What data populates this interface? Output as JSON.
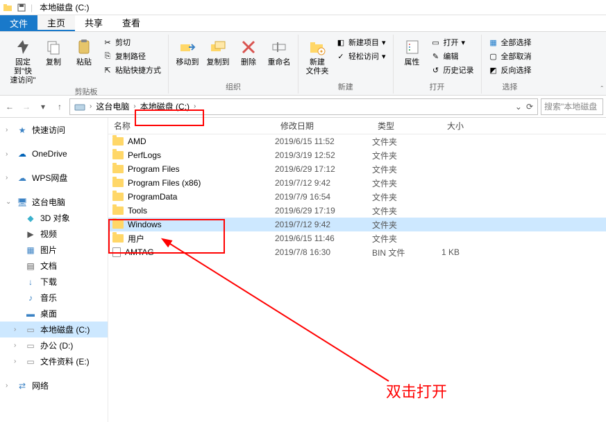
{
  "titlebar": {
    "title": "本地磁盘 (C:)"
  },
  "menubar": {
    "file": "文件",
    "tabs": [
      "主页",
      "共享",
      "查看"
    ],
    "active": 0
  },
  "ribbon": {
    "pin": {
      "label": "固定到\"快\n速访问\""
    },
    "copy": {
      "label": "复制"
    },
    "paste": {
      "label": "粘贴"
    },
    "cut": {
      "label": "剪切"
    },
    "copy_path": {
      "label": "复制路径"
    },
    "paste_shortcut": {
      "label": "粘贴快捷方式"
    },
    "clipboard": {
      "label": "剪贴板"
    },
    "move_to": {
      "label": "移动到"
    },
    "copy_to": {
      "label": "复制到"
    },
    "delete": {
      "label": "删除"
    },
    "rename": {
      "label": "重命名"
    },
    "organize": {
      "label": "组织"
    },
    "new_folder": {
      "label": "新建\n文件夹"
    },
    "new_item": {
      "label": "新建项目"
    },
    "easy_access": {
      "label": "轻松访问"
    },
    "new": {
      "label": "新建"
    },
    "properties": {
      "label": "属性"
    },
    "open": {
      "label": "打开"
    },
    "edit": {
      "label": "编辑"
    },
    "history": {
      "label": "历史记录"
    },
    "open_group": {
      "label": "打开"
    },
    "select_all": {
      "label": "全部选择"
    },
    "select_none": {
      "label": "全部取消"
    },
    "invert_selection": {
      "label": "反向选择"
    },
    "select": {
      "label": "选择"
    }
  },
  "breadcrumb": {
    "items": [
      "这台电脑",
      "本地磁盘 (C:)"
    ]
  },
  "search": {
    "placeholder": "搜索\"本地磁盘"
  },
  "columns": {
    "name": "名称",
    "date": "修改日期",
    "type": "类型",
    "size": "大小"
  },
  "files": [
    {
      "name": "AMD",
      "date": "2019/6/15 11:52",
      "type": "文件夹",
      "size": "",
      "icon": "folder"
    },
    {
      "name": "PerfLogs",
      "date": "2019/3/19 12:52",
      "type": "文件夹",
      "size": "",
      "icon": "folder"
    },
    {
      "name": "Program Files",
      "date": "2019/6/29 17:12",
      "type": "文件夹",
      "size": "",
      "icon": "folder"
    },
    {
      "name": "Program Files (x86)",
      "date": "2019/7/12 9:42",
      "type": "文件夹",
      "size": "",
      "icon": "folder"
    },
    {
      "name": "ProgramData",
      "date": "2019/7/9 16:54",
      "type": "文件夹",
      "size": "",
      "icon": "folder"
    },
    {
      "name": "Tools",
      "date": "2019/6/29 17:19",
      "type": "文件夹",
      "size": "",
      "icon": "folder"
    },
    {
      "name": "Windows",
      "date": "2019/7/12 9:42",
      "type": "文件夹",
      "size": "",
      "icon": "folder",
      "selected": true
    },
    {
      "name": "用户",
      "date": "2019/6/15 11:46",
      "type": "文件夹",
      "size": "",
      "icon": "folder"
    },
    {
      "name": "AMTAG",
      "date": "2019/7/8 16:30",
      "type": "BIN 文件",
      "size": "1 KB",
      "icon": "file"
    }
  ],
  "sidebar": {
    "quick_access": "快速访问",
    "onedrive": "OneDrive",
    "wps": "WPS网盘",
    "this_pc": "这台电脑",
    "objects_3d": "3D 对象",
    "videos": "视频",
    "pictures": "图片",
    "documents": "文档",
    "downloads": "下载",
    "music": "音乐",
    "desktop": "桌面",
    "local_c": "本地磁盘 (C:)",
    "office_d": "办公 (D:)",
    "files_e": "文件资料 (E:)",
    "network": "网络"
  },
  "annotation": {
    "text": "双击打开"
  }
}
